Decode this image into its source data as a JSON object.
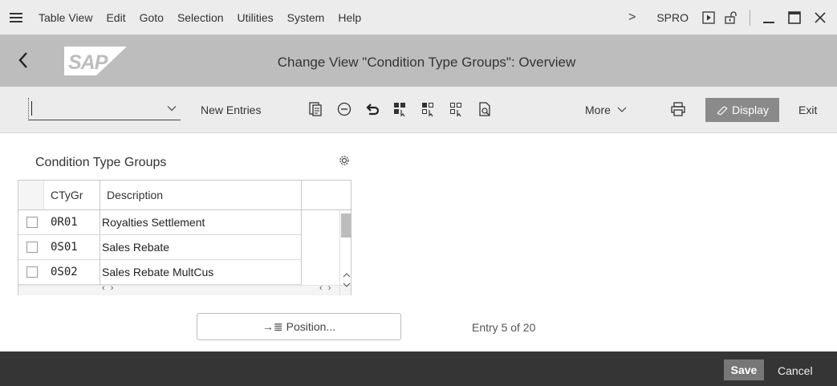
{
  "menu": {
    "items": [
      "Table View",
      "Edit",
      "Goto",
      "Selection",
      "Utilities",
      "System",
      "Help"
    ],
    "tcode": "SPRO"
  },
  "title": {
    "page_title": "Change View \"Condition Type Groups\": Overview",
    "logo_text": "SAP"
  },
  "toolbar": {
    "command_value": "",
    "new_entries": "New Entries",
    "more": "More",
    "display": "Display",
    "exit": "Exit"
  },
  "table": {
    "title": "Condition Type Groups",
    "columns": [
      "CTyGr",
      "Description"
    ],
    "rows": [
      {
        "code": "0R01",
        "description": "Royalties Settlement"
      },
      {
        "code": "0S01",
        "description": "Sales Rebate"
      },
      {
        "code": "0S02",
        "description": "Sales Rebate MultCus"
      }
    ]
  },
  "position_button": "Position...",
  "entry_info": "Entry 5 of 20",
  "footer": {
    "save": "Save",
    "cancel": "Cancel"
  },
  "colors": {
    "menubar_bg": "#ececec",
    "titlebar_bg": "#bdbdbd",
    "footer_bg": "#353535",
    "display_button_bg": "#8a8a8a",
    "sap_logo": "#ffffff"
  }
}
